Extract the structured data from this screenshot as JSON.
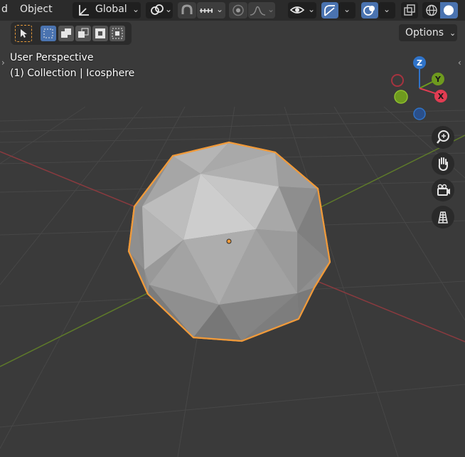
{
  "header": {
    "partial_left": "d",
    "mode_label": "Object",
    "transform_orientation": "Global",
    "icons": [
      "orientation-axes-icon",
      "pivot-point-icon",
      "snap-icon",
      "snap-increment-icon",
      "proportional-edit-icon",
      "proportional-falloff-icon",
      "visibility-eye-icon",
      "gizmo-icon",
      "overlay-icon",
      "xray-icon",
      "wireframe-shading-icon",
      "solid-shading-icon"
    ]
  },
  "tool_settings": {
    "select_modes": [
      "select-box-icon",
      "select-new-icon",
      "select-extend-icon",
      "select-subtract-icon",
      "select-invert-icon",
      "select-intersect-icon"
    ],
    "options_label": "Options"
  },
  "viewport": {
    "view_name": "User Perspective",
    "collection_label": "(1) Collection | Icosphere"
  },
  "navigation_gizmo": {
    "axes": [
      {
        "label": "Z",
        "color": "#2f73c9"
      },
      {
        "label": "Y",
        "color": "#6e9a1e"
      },
      {
        "label": "X",
        "color": "#e23c52"
      }
    ],
    "buttons": [
      "zoom-icon",
      "pan-hand-icon",
      "camera-view-icon",
      "ortho-grid-icon"
    ]
  },
  "colors": {
    "background": "#3a3a3a",
    "header": "#2b2b2b",
    "selection_outline": "#f09a3a",
    "accent_blue": "#4a73b0"
  }
}
